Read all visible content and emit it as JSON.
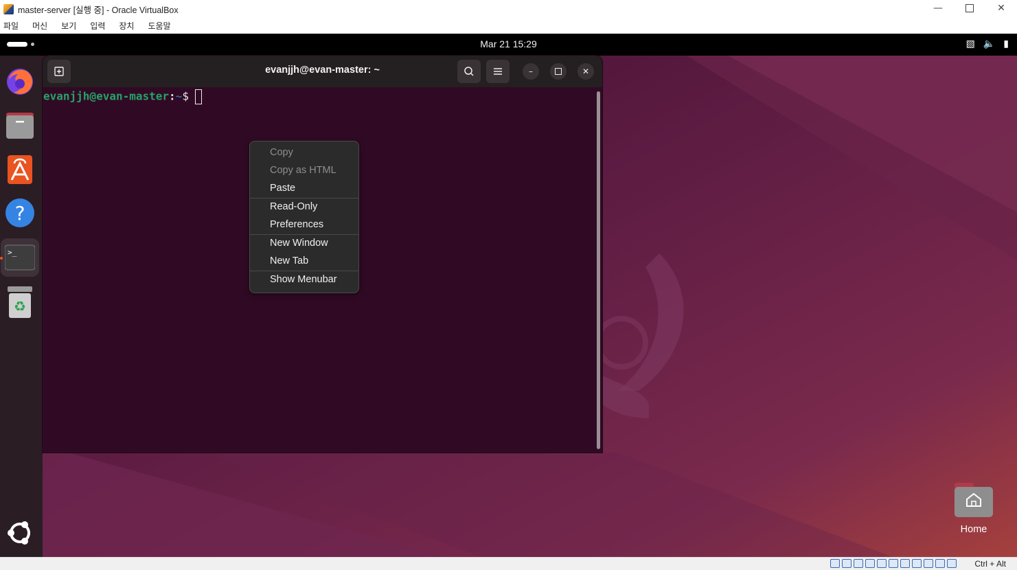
{
  "host": {
    "title": "master-server [실행 중] - Oracle VirtualBox",
    "menu": [
      "파일",
      "머신",
      "보기",
      "입력",
      "장치",
      "도움말"
    ],
    "hostkey": "Ctrl + Alt"
  },
  "topbar": {
    "clock": "Mar 21  15:29"
  },
  "dock": {
    "items": [
      "firefox-icon",
      "files-icon",
      "app-center-icon",
      "help-icon",
      "terminal-icon",
      "trash-icon",
      "ubuntu-logo-icon"
    ]
  },
  "terminal": {
    "title": "evanjjh@evan-master: ~",
    "prompt_user": "evanjjh@evan-master",
    "prompt_colon": ":",
    "prompt_path": "~",
    "prompt_sign": "$"
  },
  "context_menu": {
    "copy": "Copy",
    "copy_html": "Copy as HTML",
    "paste": "Paste",
    "read_only": "Read-Only",
    "preferences": "Preferences",
    "new_window": "New Window",
    "new_tab": "New Tab",
    "show_menubar": "Show Menubar"
  },
  "desktop": {
    "home_label": "Home"
  },
  "colors": {
    "terminal_bg": "#300a24",
    "prompt_user": "#26a269",
    "prompt_path": "#3465a4",
    "accent": "#e95420"
  }
}
